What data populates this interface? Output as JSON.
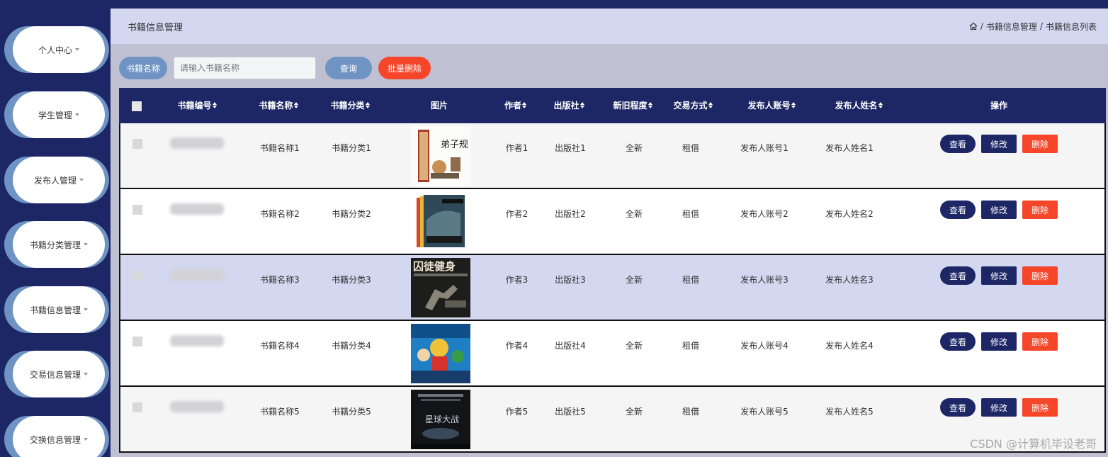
{
  "sidebar": {
    "items": [
      {
        "label": "个人中心"
      },
      {
        "label": "学生管理"
      },
      {
        "label": "发布人管理"
      },
      {
        "label": "书籍分类管理"
      },
      {
        "label": "书籍信息管理"
      },
      {
        "label": "交易信息管理"
      },
      {
        "label": "交换信息管理"
      }
    ]
  },
  "header": {
    "title": "书籍信息管理",
    "breadcrumb": [
      "书籍信息管理",
      "书籍信息列表"
    ],
    "separator": "/"
  },
  "search": {
    "label": "书籍名称",
    "placeholder": "请输入书籍名称",
    "value": "",
    "query_label": "查询",
    "batch_delete_label": "批量删除"
  },
  "table": {
    "columns": [
      "书籍编号",
      "书籍名称",
      "书籍分类",
      "图片",
      "作者",
      "出版社",
      "新旧程度",
      "交易方式",
      "发布人账号",
      "发布人姓名",
      "操作"
    ],
    "rows": [
      {
        "name": "书籍名称1",
        "category": "书籍分类1",
        "author": "作者1",
        "publisher": "出版社1",
        "condition": "全新",
        "trade": "租借",
        "account": "发布人账号1",
        "poster": "发布人姓名1"
      },
      {
        "name": "书籍名称2",
        "category": "书籍分类2",
        "author": "作者2",
        "publisher": "出版社2",
        "condition": "全新",
        "trade": "租借",
        "account": "发布人账号2",
        "poster": "发布人姓名2"
      },
      {
        "name": "书籍名称3",
        "category": "书籍分类3",
        "author": "作者3",
        "publisher": "出版社3",
        "condition": "全新",
        "trade": "租借",
        "account": "发布人账号3",
        "poster": "发布人姓名3"
      },
      {
        "name": "书籍名称4",
        "category": "书籍分类4",
        "author": "作者4",
        "publisher": "出版社4",
        "condition": "全新",
        "trade": "租借",
        "account": "发布人账号4",
        "poster": "发布人姓名4"
      },
      {
        "name": "书籍名称5",
        "category": "书籍分类5",
        "author": "作者5",
        "publisher": "出版社5",
        "condition": "全新",
        "trade": "租借",
        "account": "发布人账号5",
        "poster": "发布人姓名5"
      }
    ],
    "actions": {
      "view": "查看",
      "edit": "修改",
      "delete": "删除"
    }
  },
  "cover_texts": {
    "book1": "弟子规",
    "book3": "囚徒健身",
    "book5": "星球大战"
  },
  "watermark": "CSDN @计算机毕设老哥",
  "colors": {
    "navy": "#1e2766",
    "accent_blue": "#6f94c4",
    "danger": "#f5462a",
    "highlight_row": "#d3d7f0"
  }
}
